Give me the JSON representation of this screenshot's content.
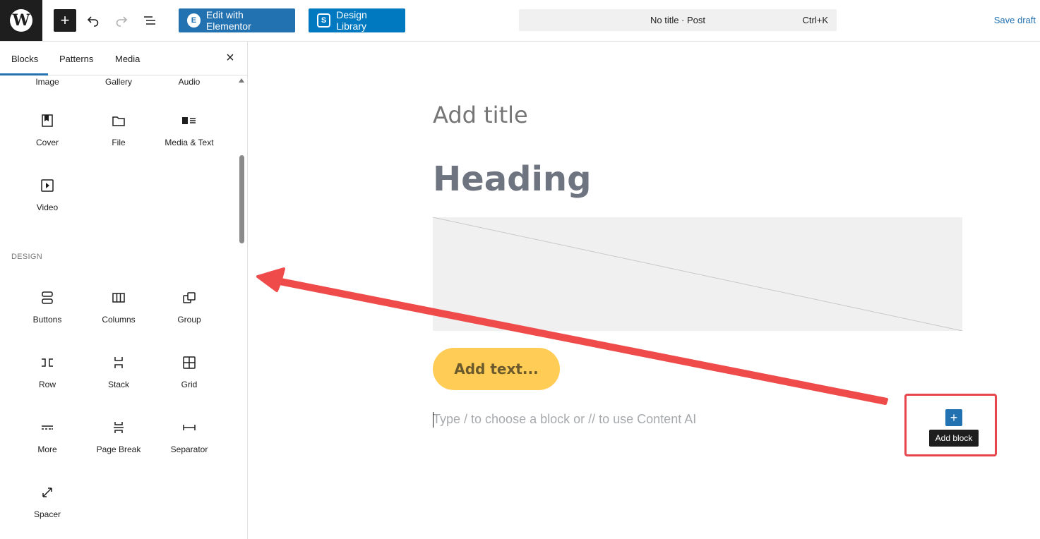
{
  "topbar": {
    "logo_icon": "wordpress-logo-icon",
    "elementor_button": "Edit with Elementor",
    "design_library_button": "Design Library",
    "document_title": "No title · Post",
    "shortcut": "Ctrl+K",
    "save_draft": "Save draft"
  },
  "sidebar": {
    "tabs": [
      "Blocks",
      "Patterns",
      "Media"
    ],
    "active_tab": "Blocks",
    "media_blocks_top": [
      "Image",
      "Gallery",
      "Audio"
    ],
    "media_blocks": [
      {
        "label": "Cover",
        "icon": "cover-icon"
      },
      {
        "label": "File",
        "icon": "file-icon"
      },
      {
        "label": "Media & Text",
        "icon": "media-text-icon"
      },
      {
        "label": "Video",
        "icon": "video-icon"
      }
    ],
    "design_heading": "DESIGN",
    "design_blocks": [
      {
        "label": "Buttons",
        "icon": "buttons-icon"
      },
      {
        "label": "Columns",
        "icon": "columns-icon"
      },
      {
        "label": "Group",
        "icon": "group-icon"
      },
      {
        "label": "Row",
        "icon": "row-icon"
      },
      {
        "label": "Stack",
        "icon": "stack-icon"
      },
      {
        "label": "Grid",
        "icon": "grid-icon"
      },
      {
        "label": "More",
        "icon": "more-icon"
      },
      {
        "label": "Page Break",
        "icon": "page-break-icon"
      },
      {
        "label": "Separator",
        "icon": "separator-icon"
      },
      {
        "label": "Spacer",
        "icon": "spacer-icon"
      }
    ]
  },
  "editor": {
    "title_placeholder": "Add title",
    "heading": "Heading",
    "button_text": "Add text...",
    "paragraph_placeholder": "Type / to choose a block or // to use Content AI",
    "add_block_tooltip": "Add block"
  },
  "colors": {
    "accent": "#2271b1",
    "annotation": "#e8464f",
    "button_yellow": "#ffcc55"
  }
}
